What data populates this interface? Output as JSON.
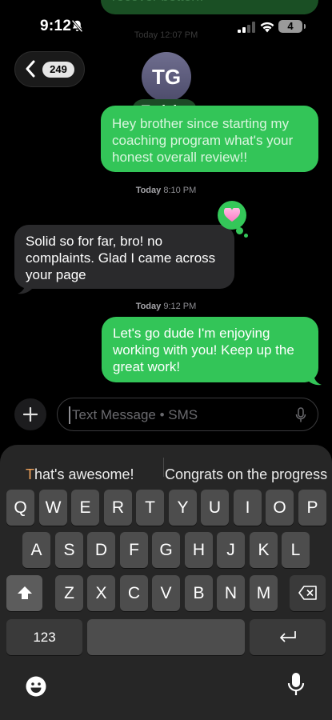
{
  "status_bar": {
    "time": "9:12",
    "battery": "4"
  },
  "thread": {
    "top_bubble_text": "recover better!!",
    "top_timestamp": "Today 12:07 PM",
    "back_count": "249",
    "avatar_initials": "TG",
    "contact_name": "Tarick",
    "messages": [
      {
        "direction": "outgoing",
        "text": "Hey brother since starting my coaching program what's your honest overall review!!"
      },
      {
        "direction": "incoming",
        "text": "Solid so for far, bro! no complaints. Glad I came across your page",
        "tapback": "heart"
      },
      {
        "direction": "outgoing",
        "text": "Let's go dude I'm enjoying working with you! Keep up the great work!"
      }
    ],
    "timestamps": [
      {
        "day": "Today",
        "time": "8:10 PM"
      },
      {
        "day": "Today",
        "time": "9:12 PM"
      }
    ]
  },
  "compose": {
    "placeholder": "Text Message • SMS"
  },
  "keyboard": {
    "suggestions": [
      "That's awesome!",
      "Congrats on the progress"
    ],
    "rows": [
      [
        "Q",
        "W",
        "E",
        "R",
        "T",
        "Y",
        "U",
        "I",
        "O",
        "P"
      ],
      [
        "A",
        "S",
        "D",
        "F",
        "G",
        "H",
        "J",
        "K",
        "L"
      ],
      [
        "Z",
        "X",
        "C",
        "V",
        "B",
        "N",
        "M"
      ]
    ],
    "numbers_key": "123"
  },
  "colors": {
    "outgoing_bubble": "#33c558",
    "incoming_bubble": "#2a2a2c",
    "keyboard_bg": "#262626"
  },
  "icons": [
    "bell-slash-icon",
    "cellular-signal-icon",
    "wifi-icon",
    "battery-icon",
    "back-chevron-icon",
    "heart-icon",
    "plus-icon",
    "microphone-icon",
    "shift-icon",
    "backspace-icon",
    "return-icon",
    "emoji-icon",
    "dictation-icon"
  ]
}
